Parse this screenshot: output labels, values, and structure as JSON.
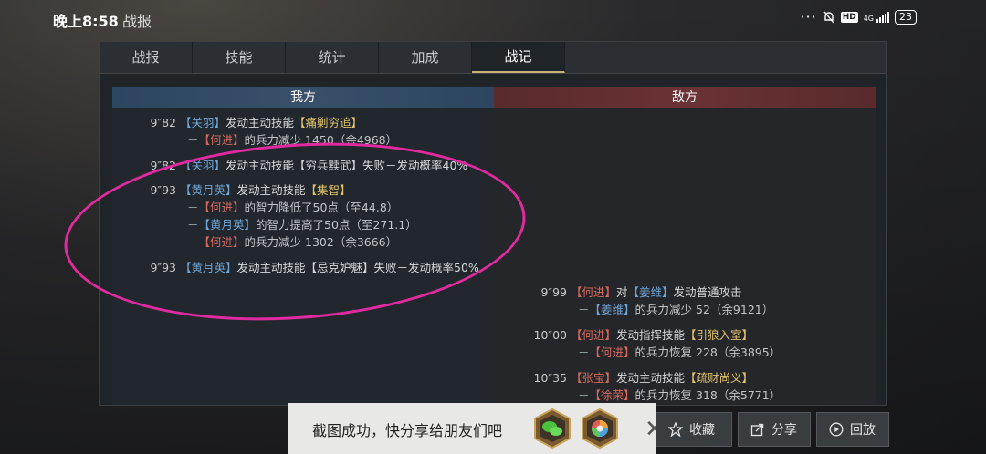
{
  "status": {
    "time": "晚上8:58",
    "title": "战报",
    "hd": "HD",
    "battery": "23",
    "signal": "4G"
  },
  "tabs": [
    {
      "label": "战报"
    },
    {
      "label": "技能"
    },
    {
      "label": "统计"
    },
    {
      "label": "加成"
    },
    {
      "label": "战记"
    }
  ],
  "headers": {
    "us": "我方",
    "enemy": "敌方"
  },
  "log": {
    "e1": {
      "time": "9″82",
      "actor": "【关羽】",
      "text": "发动主动技能",
      "skill": "【痛剿穷追】"
    },
    "e1s1": {
      "dash": "－",
      "target": "【何进】",
      "text": "的兵力减少 1450（余4968）"
    },
    "e2": {
      "time": "9″82",
      "actor": "【关羽】",
      "text": "发动主动技能【穷兵黩武】失败－发动概率40%"
    },
    "e3": {
      "time": "9″93",
      "actor": "【黄月英】",
      "text": "发动主动技能",
      "skill": "【集智】"
    },
    "e3s1": {
      "dash": "－",
      "target": "【何进】",
      "text": "的智力降低了50点（至44.8）"
    },
    "e3s2": {
      "dash": "－",
      "target": "【黄月英】",
      "text": "的智力提高了50点（至271.1）"
    },
    "e3s3": {
      "dash": "－",
      "target": "【何进】",
      "text": "的兵力减少 1302（余3666）"
    },
    "e4": {
      "time": "9″93",
      "actor": "【黄月英】",
      "text": "发动主动技能【忌克妒魅】失败－发动概率50%"
    },
    "e5": {
      "time": "9″99",
      "actor": "【何进】",
      "mid": "对",
      "target": "【姜维】",
      "text": "发动普通攻击"
    },
    "e5s1": {
      "dash": "－",
      "target": "【姜维】",
      "text": "的兵力减少 52（余9121）"
    },
    "e6": {
      "time": "10″00",
      "actor": "【何进】",
      "text": "发动指挥技能",
      "skill": "【引狼入室】"
    },
    "e6s1": {
      "dash": "－",
      "target": "【何进】",
      "text": "的兵力恢复 228（余3895）"
    },
    "e7": {
      "time": "10″35",
      "actor": "【张宝】",
      "text": "发动主动技能",
      "skill": "【疏财尚义】"
    },
    "e7s1": {
      "dash": "－",
      "target": "【徐荣】",
      "text": "的兵力恢复 318（余5771）"
    }
  },
  "toast": {
    "text": "截图成功，快分享给朋友们吧"
  },
  "actions": {
    "collect": "收藏",
    "share": "分享",
    "replay": "回放"
  },
  "icons": [
    "wechat-icon",
    "moments-icon",
    "close-icon",
    "star-icon",
    "share-icon",
    "play-icon"
  ]
}
